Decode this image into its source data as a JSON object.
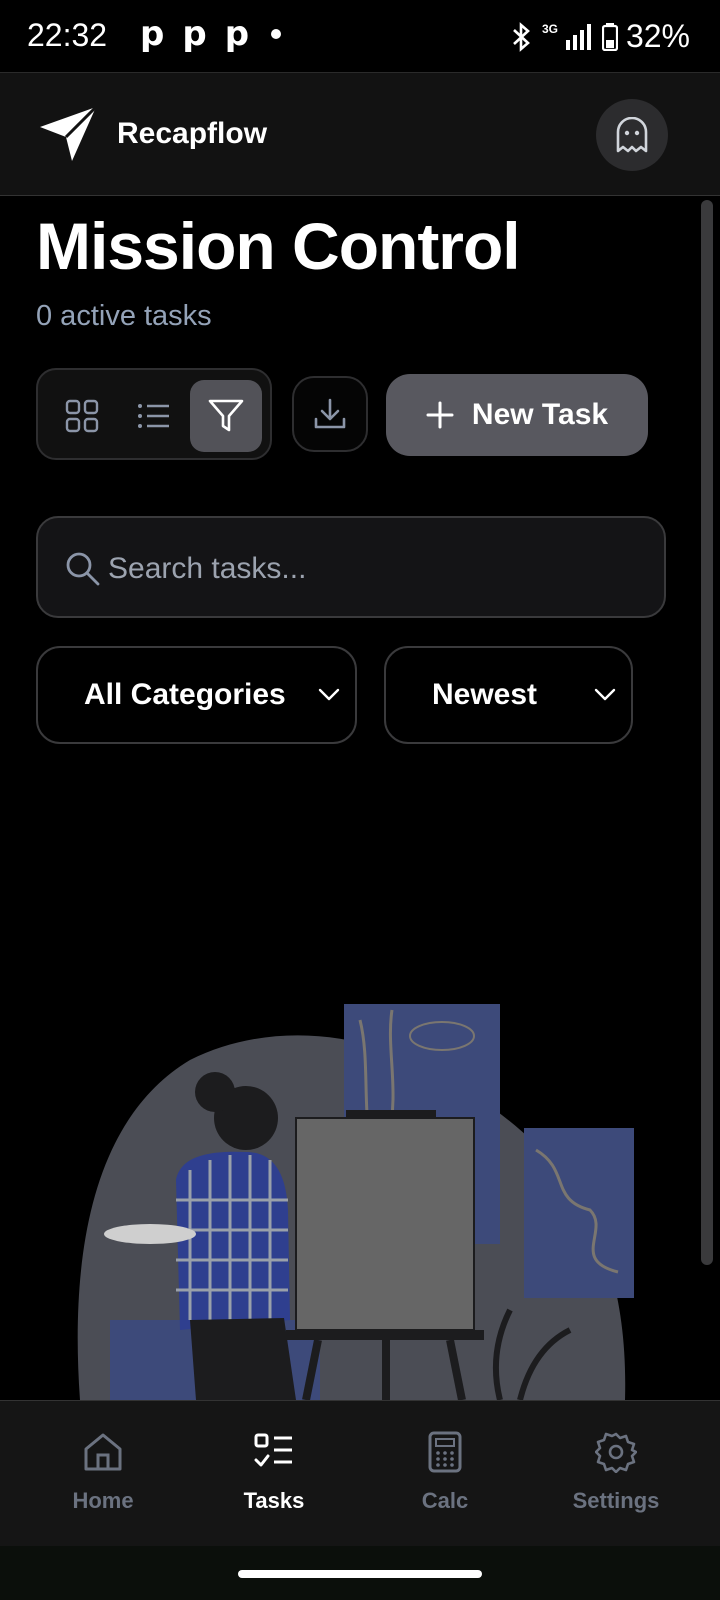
{
  "status_bar": {
    "time": "22:32",
    "notification_icons": [
      "p",
      "p",
      "p"
    ],
    "network_label": "3G",
    "battery_percent": "32%"
  },
  "header": {
    "app_name": "Recapflow",
    "logo_icon": "paper-plane-icon",
    "avatar_icon": "ghost-icon"
  },
  "main": {
    "title": "Mission Control",
    "subtitle": "0 active tasks",
    "toolbar": {
      "view_icons": [
        "grid-icon",
        "list-icon",
        "filter-icon"
      ],
      "active_view": "filter",
      "download_icon": "download-icon",
      "new_task_label": "New Task"
    },
    "search": {
      "placeholder": "Search tasks...",
      "value": ""
    },
    "filters": {
      "category_selected": "All Categories",
      "sort_selected": "Newest"
    }
  },
  "bottom_nav": {
    "items": [
      {
        "label": "Home",
        "icon": "home-icon",
        "active": false
      },
      {
        "label": "Tasks",
        "icon": "tasks-icon",
        "active": true
      },
      {
        "label": "Calc",
        "icon": "calculator-icon",
        "active": false
      },
      {
        "label": "Settings",
        "icon": "gear-icon",
        "active": false
      }
    ]
  },
  "colors": {
    "background": "#000000",
    "header_bg": "#121212",
    "muted_text": "#94a3b8",
    "button_bg": "#58585f",
    "active_toggle": "#525258",
    "illustration_accent": "#3d4a7a"
  }
}
